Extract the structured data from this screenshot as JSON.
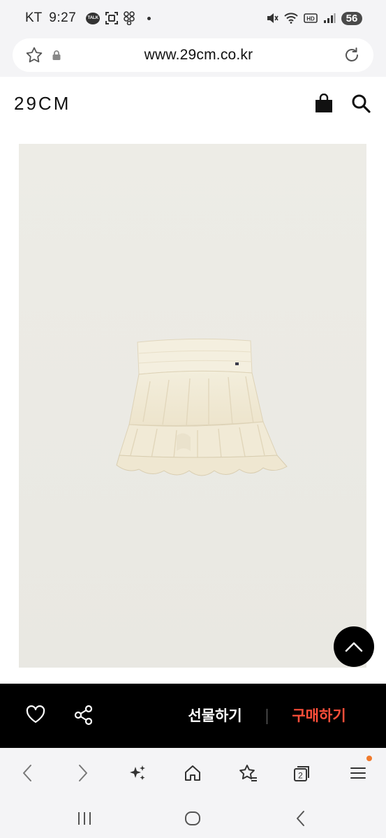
{
  "status_bar": {
    "carrier": "KT",
    "time": "9:27",
    "talk_badge": "TALK",
    "battery": "56",
    "icons_left": [
      "kakaotalk-icon",
      "screen-capture-icon",
      "app-grid-icon",
      "notification-dot"
    ],
    "icons_right": [
      "mute-icon",
      "wifi-icon",
      "hd-icon",
      "signal-icon",
      "battery-icon"
    ]
  },
  "browser": {
    "url": "www.29cm.co.kr",
    "icons": [
      "bookmark-star-icon",
      "lock-icon",
      "reload-icon"
    ]
  },
  "site_header": {
    "logo": "29CM",
    "icons": [
      "shopping-bag-icon",
      "search-icon"
    ]
  },
  "product": {
    "image_subject": "cream tiered ruffle mini skirt",
    "colors": {
      "background": "#ecebe5",
      "skirt": "#f2ecd9",
      "skirt_shadow": "#e1d8c0"
    }
  },
  "scroll_top": {
    "icon": "chevron-up-icon"
  },
  "purchase_bar": {
    "like_icon": "heart-icon",
    "share_icon": "share-icon",
    "gift_label": "선물하기",
    "buy_label": "구매하기",
    "buy_color": "#ff4f3a"
  },
  "browser_nav": {
    "items": [
      "back-icon",
      "forward-icon",
      "ai-sparkle-icon",
      "home-icon",
      "bookmarks-icon",
      "tabs-icon",
      "menu-icon"
    ],
    "tab_count": "2"
  },
  "system_nav": {
    "items": [
      "recent-apps-icon",
      "home-circle-icon",
      "back-icon"
    ]
  }
}
